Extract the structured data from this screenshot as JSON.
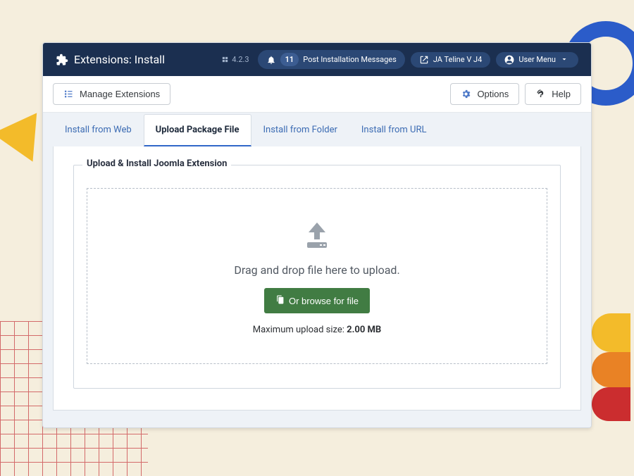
{
  "header": {
    "title": "Extensions: Install",
    "version": "4.2.3",
    "notif_count": "11",
    "post_install_label": "Post Installation Messages",
    "site_name": "JA Teline V J4",
    "user_menu_label": "User Menu"
  },
  "toolbar": {
    "manage_label": "Manage Extensions",
    "options_label": "Options",
    "help_label": "Help"
  },
  "tabs": {
    "web": "Install from Web",
    "upload": "Upload Package File",
    "folder": "Install from Folder",
    "url": "Install from URL",
    "active": "upload"
  },
  "upload": {
    "legend": "Upload & Install Joomla Extension",
    "drop_text": "Drag and drop file here to upload.",
    "browse_label": "Or browse for file",
    "max_prefix": "Maximum upload size: ",
    "max_size": "2.00 MB"
  }
}
